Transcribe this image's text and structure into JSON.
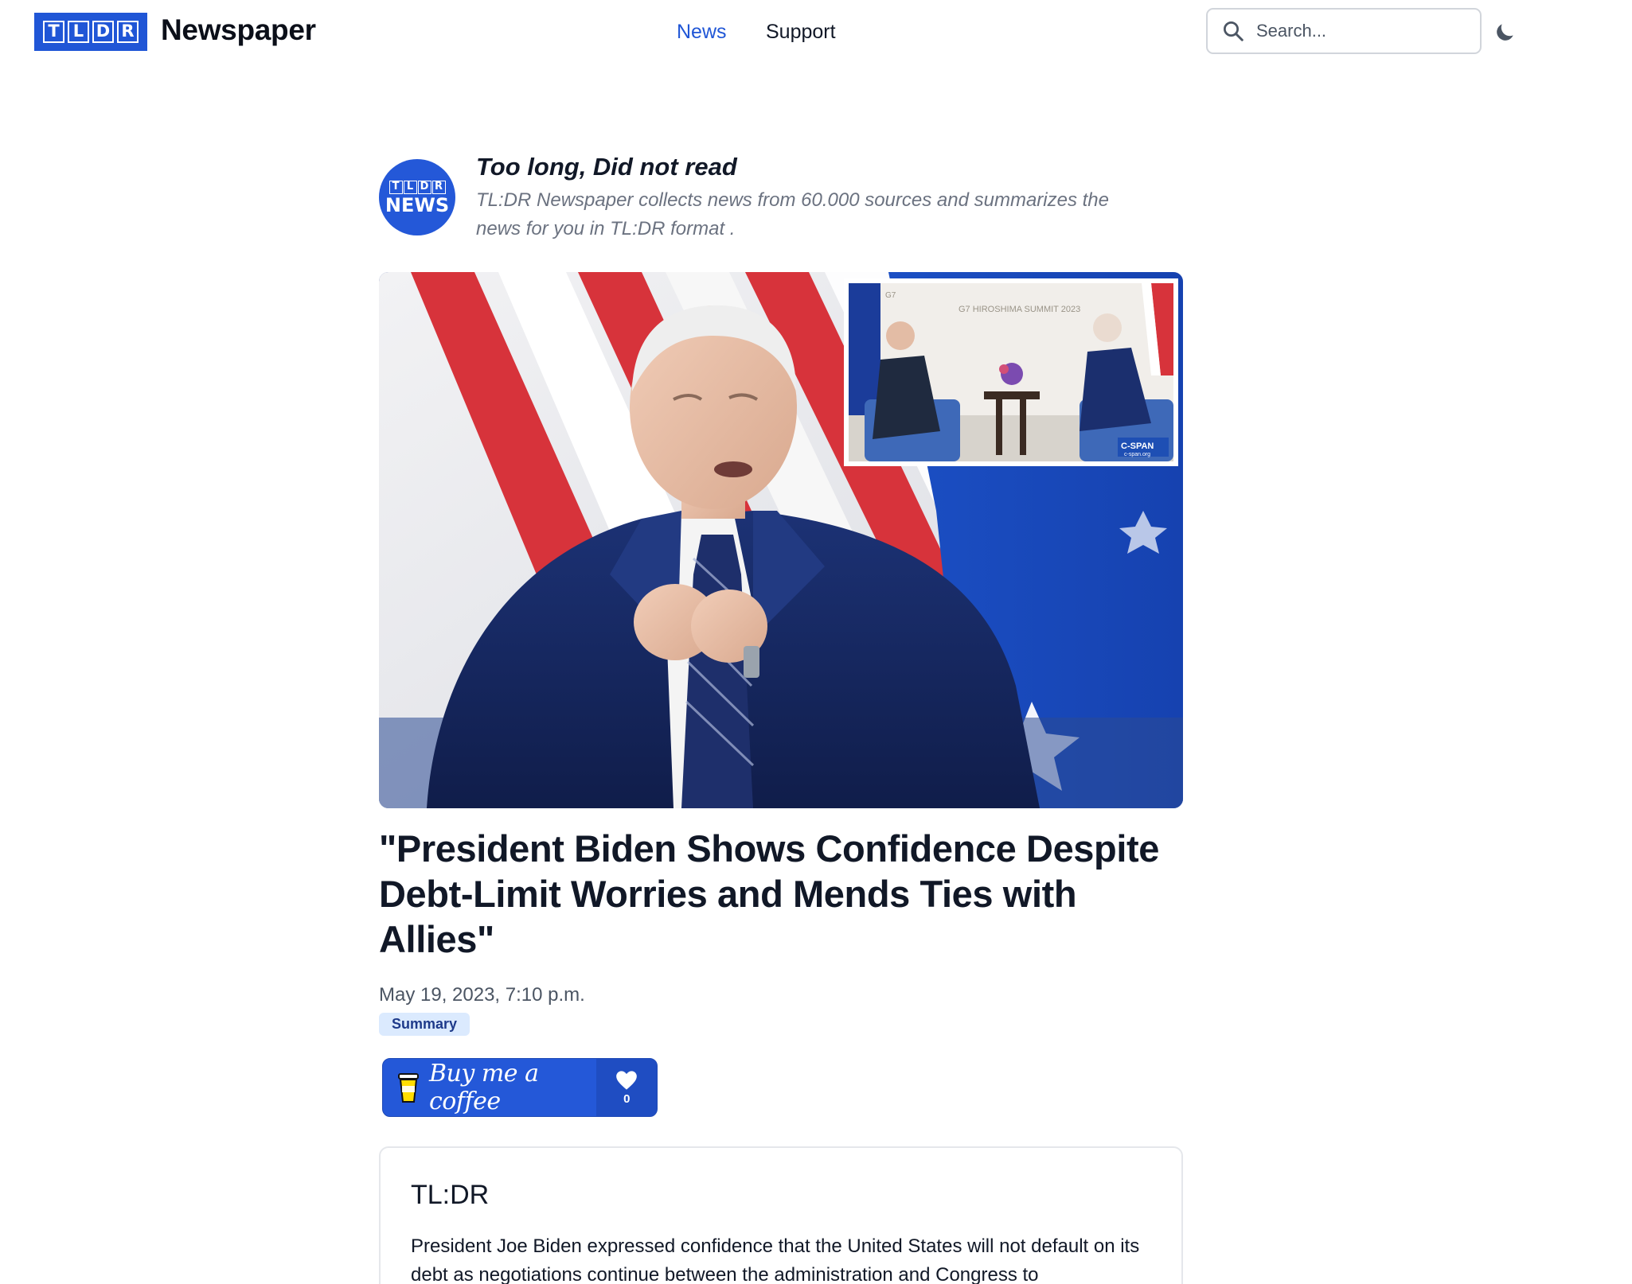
{
  "header": {
    "logo_letters": [
      "T",
      "L",
      "D",
      "R"
    ],
    "brand": "Newspaper",
    "nav": [
      {
        "label": "News",
        "active": true
      },
      {
        "label": "Support",
        "active": false
      }
    ],
    "search_placeholder": "Search...",
    "theme_icon": "moon-icon"
  },
  "intro": {
    "avatar_letters": [
      "T",
      "L",
      "D",
      "R"
    ],
    "avatar_word": "NEWS",
    "title": "Too long, Did not read",
    "description": "TL:DR Newspaper collects news from 60.000 sources and summarizes the news for you in TL:DR format ."
  },
  "hero": {
    "inset_caption": "G7 HIROSHIMA SUMMIT 2023",
    "inset_badge": "C-SPAN",
    "inset_badge_url": "c-span.org",
    "inset_g7": "G7"
  },
  "article": {
    "headline": "\"President Biden Shows Confidence Despite Debt-Limit Worries and Mends Ties with Allies\"",
    "date": "May 19, 2023, 7:10 p.m.",
    "tag": "Summary"
  },
  "coffee": {
    "label": "Buy me a coffee",
    "likes": "0"
  },
  "tldr": {
    "title": "TL:DR",
    "body": "President Joe Biden expressed confidence that the United States will not default on its debt as negotiations continue between the administration and Congress to"
  },
  "colors": {
    "brand_blue": "#2056d6",
    "nav_active": "#2056d6",
    "tag_bg": "#dbeafe"
  }
}
